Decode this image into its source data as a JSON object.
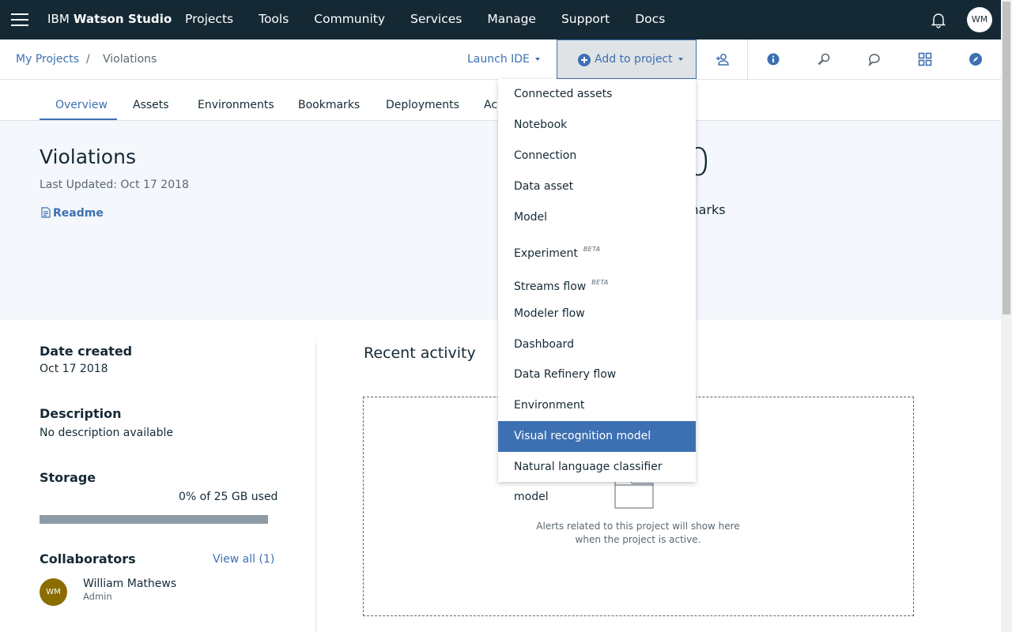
{
  "topbar": {
    "brand_prefix": "IBM",
    "brand_name": "Watson Studio",
    "nav": [
      "Projects",
      "Tools",
      "Community",
      "Services",
      "Manage",
      "Support",
      "Docs"
    ],
    "avatar_initials": "WM"
  },
  "breadcrumb": {
    "root": "My Projects",
    "separator": "/",
    "current": "Violations"
  },
  "toolbar": {
    "launch_ide": "Launch IDE",
    "add_to_project": "Add to project",
    "icons": [
      "add-collaborator-icon",
      "info-icon",
      "find-icon",
      "chat-icon",
      "grid-icon",
      "compass-icon"
    ]
  },
  "tabs": [
    "Overview",
    "Assets",
    "Environments",
    "Bookmarks",
    "Deployments",
    "Ac"
  ],
  "overview": {
    "title": "Violations",
    "last_updated": "Last Updated: Oct 17 2018",
    "readme": "Readme",
    "stat_number_visible": "0",
    "stat_caption_visible": "marks"
  },
  "details": {
    "date_created_label": "Date created",
    "date_created_value": "Oct 17 2018",
    "description_label": "Description",
    "description_value": "No description available",
    "storage_label": "Storage",
    "storage_used": "0% of 25 GB used",
    "storage_fraction": 0,
    "collaborators_label": "Collaborators",
    "view_all": "View all (1)",
    "collaborator": {
      "initials": "WM",
      "name": "William Mathews",
      "role": "Admin"
    }
  },
  "recent": {
    "title": "Recent activity",
    "empty_line1": "Alerts related to this project will show here",
    "empty_line2": "when the project is active."
  },
  "dropdown": {
    "items": [
      {
        "label": "Connected assets",
        "badge": ""
      },
      {
        "label": "Notebook",
        "badge": ""
      },
      {
        "label": "Connection",
        "badge": ""
      },
      {
        "label": "Data asset",
        "badge": ""
      },
      {
        "label": "Model",
        "badge": ""
      },
      {
        "label": "Experiment",
        "badge": "BETA"
      },
      {
        "label": "Streams flow",
        "badge": "BETA"
      },
      {
        "label": "Modeler flow",
        "badge": ""
      },
      {
        "label": "Dashboard",
        "badge": ""
      },
      {
        "label": "Data Refinery flow",
        "badge": ""
      },
      {
        "label": "Environment",
        "badge": ""
      },
      {
        "label": "Visual recognition model",
        "badge": "",
        "selected": true
      },
      {
        "label": "Natural language classifier model",
        "badge": ""
      }
    ]
  },
  "colors": {
    "topbar_bg": "#152935",
    "accent": "#3d70b2",
    "hero_bg": "#f4f7fb",
    "avatar_bg": "#8a6d00"
  }
}
